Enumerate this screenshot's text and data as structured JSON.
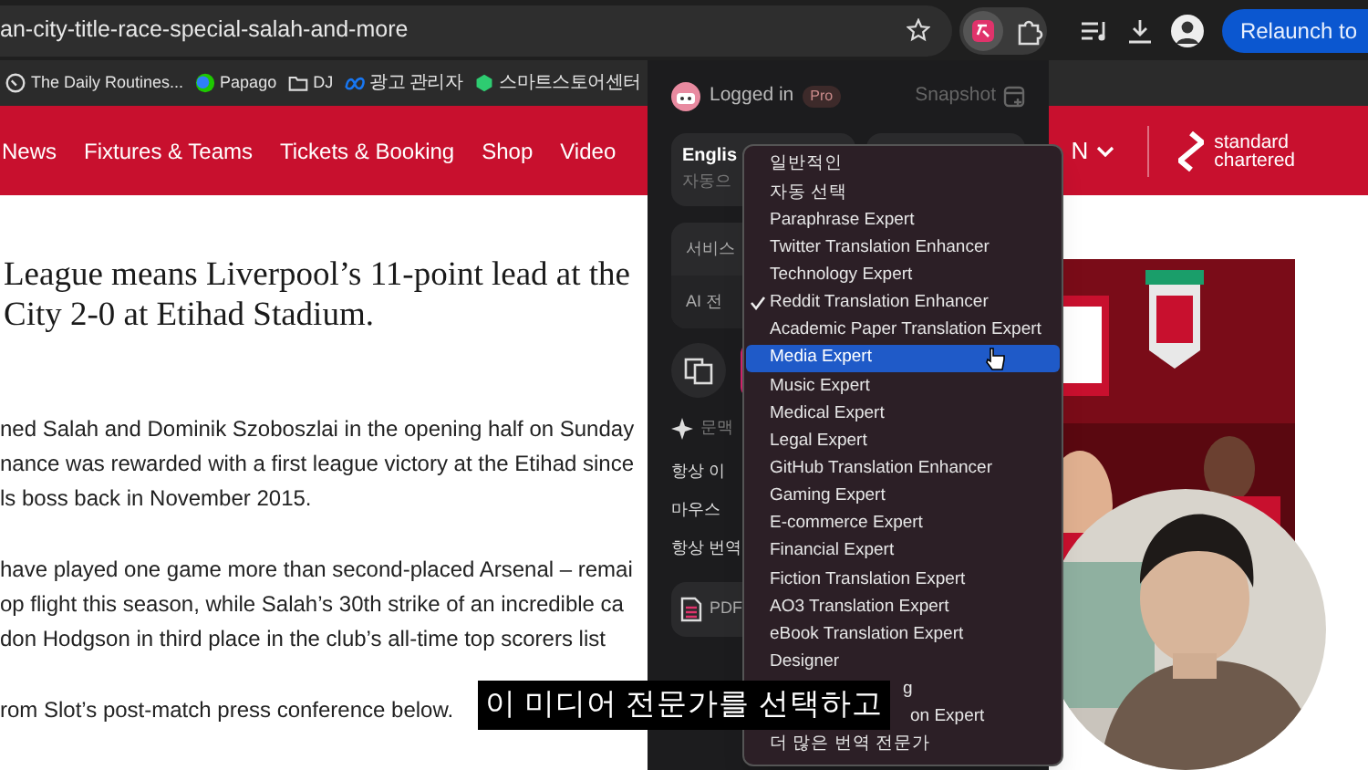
{
  "browser": {
    "address": "an-city-title-race-special-salah-and-more",
    "relaunch_button": "Relaunch to",
    "bookmarks": [
      {
        "label": "The Daily Routines...",
        "kind": "pin"
      },
      {
        "label": "Papago",
        "kind": "papago"
      },
      {
        "label": "DJ",
        "kind": "folder"
      },
      {
        "label": "광고 관리자",
        "kind": "meta"
      },
      {
        "label": "스마트스토어센터",
        "kind": "store"
      }
    ]
  },
  "site_nav": {
    "items": [
      "News",
      "Fixtures & Teams",
      "Tickets & Booking",
      "Shop",
      "Video"
    ],
    "language": "N",
    "sponsor": [
      "standard",
      "chartered"
    ]
  },
  "article": {
    "headline": [
      "League means Liverpool’s 11-point lead at the",
      "City 2-0 at Etihad Stadium."
    ],
    "paragraphs": [
      [
        "ned Salah and Dominik Szoboszlai in the opening half on Sunday",
        "nance was rewarded with a first league victory at the Etihad since",
        "ls boss back in November 2015."
      ],
      [
        "have played one game more than second-placed Arsenal – remai",
        "op flight this season, while Salah’s 30th strike of an incredible ca",
        "don Hodgson in third place in the club’s all-time top scorers list"
      ],
      [
        "rom Slot’s post-match press conference below."
      ]
    ]
  },
  "popup": {
    "status": "Logged in",
    "badge": "Pro",
    "snapshot": "Snapshot",
    "language_card": {
      "title": "Englis",
      "subtitle": "자동으"
    },
    "service_rows": [
      "서비스",
      "AI 전"
    ],
    "context_label": "문맥",
    "options": [
      "항상 이",
      "마우스",
      "항상 번역"
    ],
    "pdf": "PDF"
  },
  "dropdown": {
    "items": [
      {
        "label": "일반적인",
        "checked": false,
        "selected": false,
        "kind": "full"
      },
      {
        "label": "자동 선택",
        "checked": false,
        "selected": false,
        "kind": "full"
      },
      {
        "label": "Paraphrase Expert",
        "checked": false,
        "selected": false,
        "kind": "full"
      },
      {
        "label": "Twitter Translation Enhancer",
        "checked": false,
        "selected": false,
        "kind": "full"
      },
      {
        "label": "Technology Expert",
        "checked": false,
        "selected": false,
        "kind": "full"
      },
      {
        "label": "Reddit Translation Enhancer",
        "checked": true,
        "selected": false,
        "kind": "full"
      },
      {
        "label": "Academic Paper Translation Expert",
        "checked": false,
        "selected": false,
        "kind": "full"
      },
      {
        "label": "Media Expert",
        "checked": false,
        "selected": true,
        "kind": "full"
      },
      {
        "label": "Music Expert",
        "checked": false,
        "selected": false,
        "kind": "full"
      },
      {
        "label": "Medical Expert",
        "checked": false,
        "selected": false,
        "kind": "full"
      },
      {
        "label": "Legal Expert",
        "checked": false,
        "selected": false,
        "kind": "full"
      },
      {
        "label": "GitHub Translation Enhancer",
        "checked": false,
        "selected": false,
        "kind": "full"
      },
      {
        "label": "Gaming Expert",
        "checked": false,
        "selected": false,
        "kind": "full"
      },
      {
        "label": "E-commerce Expert",
        "checked": false,
        "selected": false,
        "kind": "full"
      },
      {
        "label": "Financial Expert",
        "checked": false,
        "selected": false,
        "kind": "full"
      },
      {
        "label": "Fiction Translation Expert",
        "checked": false,
        "selected": false,
        "kind": "full"
      },
      {
        "label": "AO3 Translation Expert",
        "checked": false,
        "selected": false,
        "kind": "full"
      },
      {
        "label": "eBook Translation Expert",
        "checked": false,
        "selected": false,
        "kind": "full"
      },
      {
        "label": "Designer",
        "checked": false,
        "selected": false,
        "kind": "full"
      },
      {
        "label": "g",
        "selected": false,
        "kind": "covered"
      },
      {
        "label": "on Expert",
        "selected": false,
        "kind": "covered"
      },
      {
        "label": "더 많은 번역 전문가",
        "checked": false,
        "selected": false,
        "kind": "full"
      }
    ]
  },
  "subtitle": "이 미디어 전문가를 선택하고"
}
